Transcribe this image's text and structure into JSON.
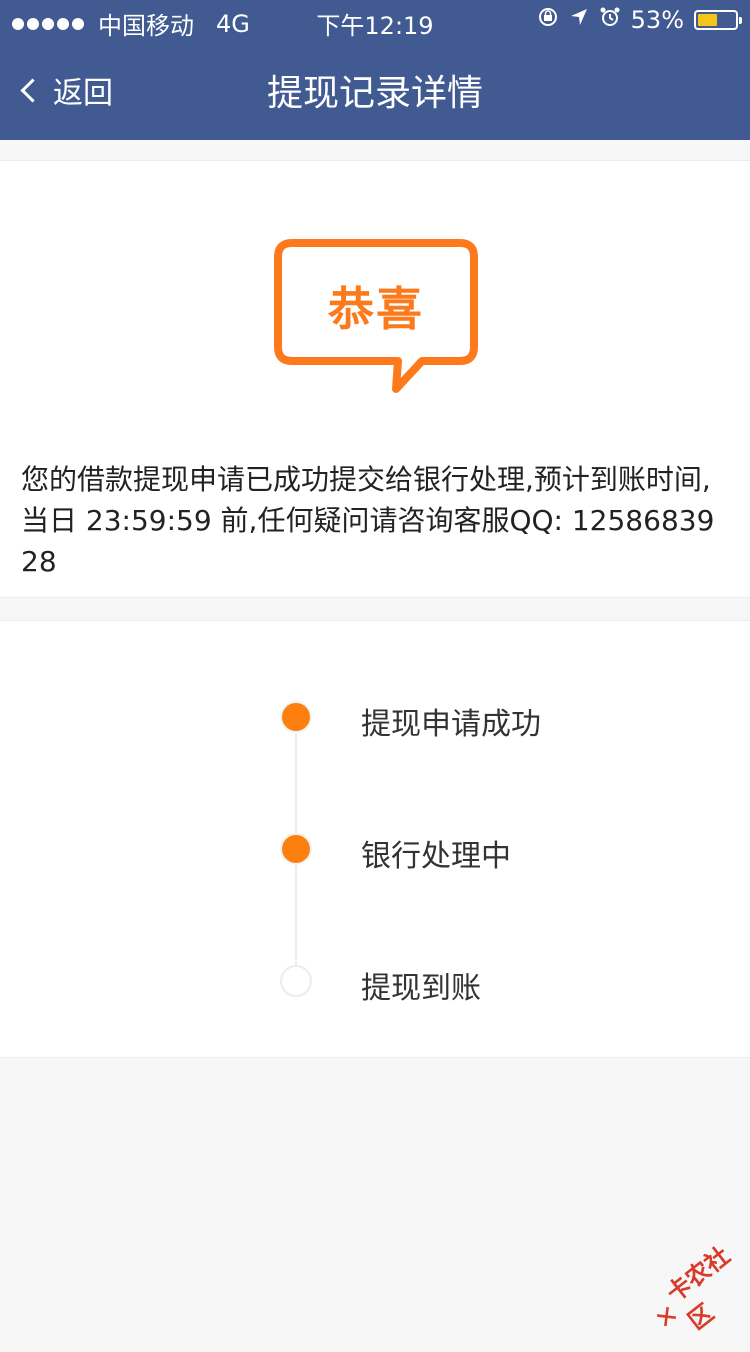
{
  "status_bar": {
    "carrier": "中国移动",
    "network": "4G",
    "time": "下午12:19",
    "battery_percent": "53%",
    "battery_level": 0.53
  },
  "nav": {
    "back_label": "返回",
    "title": "提现记录详情"
  },
  "congrats": {
    "bubble_text": "恭喜",
    "message": "您的借款提现申请已成功提交给银行处理,预计到账时间,当日 23:59:59 前,任何疑问请咨询客服QQ: 1258683928"
  },
  "timeline": {
    "steps": [
      {
        "label": "提现申请成功",
        "done": true
      },
      {
        "label": "银行处理中",
        "done": true
      },
      {
        "label": "提现到账",
        "done": false
      }
    ]
  },
  "watermark": {
    "text": "卡农社区"
  },
  "colors": {
    "nav_bg": "#415a92",
    "accent_orange": "#fd7f0e",
    "battery_yellow": "#f5c518"
  }
}
